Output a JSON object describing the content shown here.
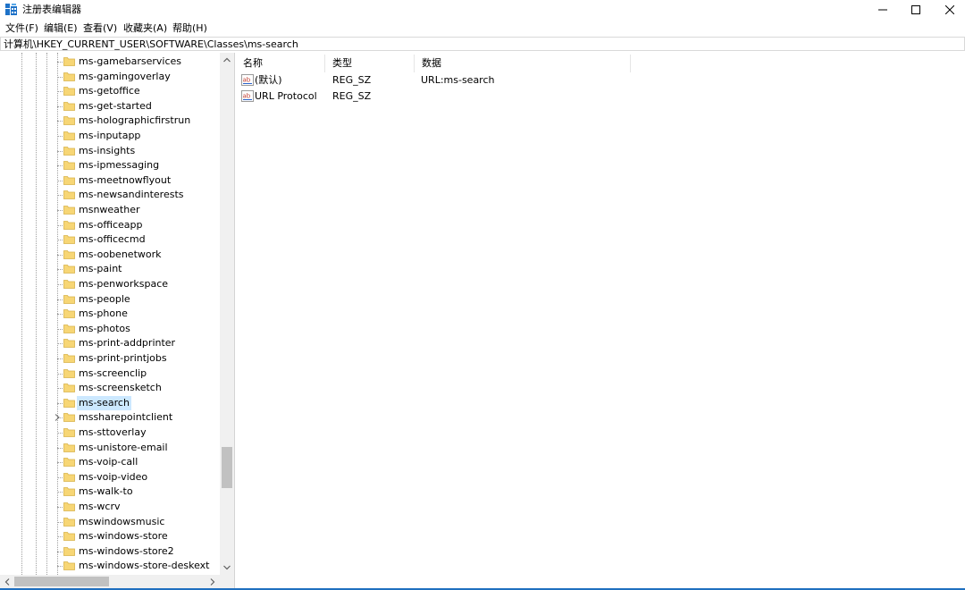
{
  "window": {
    "title": "注册表编辑器",
    "icon": "regedit-icon",
    "controls": [
      "minimize-icon",
      "maximize-icon",
      "close-icon"
    ]
  },
  "menu": [
    "文件(F)",
    "编辑(E)",
    "查看(V)",
    "收藏夹(A)",
    "帮助(H)"
  ],
  "address": "计算机\\HKEY_CURRENT_USER\\SOFTWARE\\Classes\\ms-search",
  "tree": {
    "items": [
      {
        "label": "ms-gamebarservices"
      },
      {
        "label": "ms-gamingoverlay"
      },
      {
        "label": "ms-getoffice"
      },
      {
        "label": "ms-get-started"
      },
      {
        "label": "ms-holographicfirstrun"
      },
      {
        "label": "ms-inputapp"
      },
      {
        "label": "ms-insights"
      },
      {
        "label": "ms-ipmessaging"
      },
      {
        "label": "ms-meetnowflyout"
      },
      {
        "label": "ms-newsandinterests"
      },
      {
        "label": "msnweather"
      },
      {
        "label": "ms-officeapp"
      },
      {
        "label": "ms-officecmd"
      },
      {
        "label": "ms-oobenetwork"
      },
      {
        "label": "ms-paint"
      },
      {
        "label": "ms-penworkspace"
      },
      {
        "label": "ms-people"
      },
      {
        "label": "ms-phone"
      },
      {
        "label": "ms-photos"
      },
      {
        "label": "ms-print-addprinter"
      },
      {
        "label": "ms-print-printjobs"
      },
      {
        "label": "ms-screenclip"
      },
      {
        "label": "ms-screensketch"
      },
      {
        "label": "ms-search",
        "selected": true
      },
      {
        "label": "mssharepointclient",
        "expandable": true
      },
      {
        "label": "ms-sttoverlay"
      },
      {
        "label": "ms-unistore-email"
      },
      {
        "label": "ms-voip-call"
      },
      {
        "label": "ms-voip-video"
      },
      {
        "label": "ms-walk-to"
      },
      {
        "label": "ms-wcrv"
      },
      {
        "label": "mswindowsmusic"
      },
      {
        "label": "ms-windows-store"
      },
      {
        "label": "ms-windows-store2"
      },
      {
        "label": "ms-windows-store-deskext"
      }
    ]
  },
  "list": {
    "columns": [
      "名称",
      "类型",
      "数据"
    ],
    "rows": [
      {
        "name": "(默认)",
        "type": "REG_SZ",
        "data": "URL:ms-search"
      },
      {
        "name": "URL Protocol",
        "type": "REG_SZ",
        "data": ""
      }
    ]
  },
  "colors": {
    "selection": "#cce8ff",
    "folder": "#f7d675",
    "accent": "#1f6fbf"
  }
}
